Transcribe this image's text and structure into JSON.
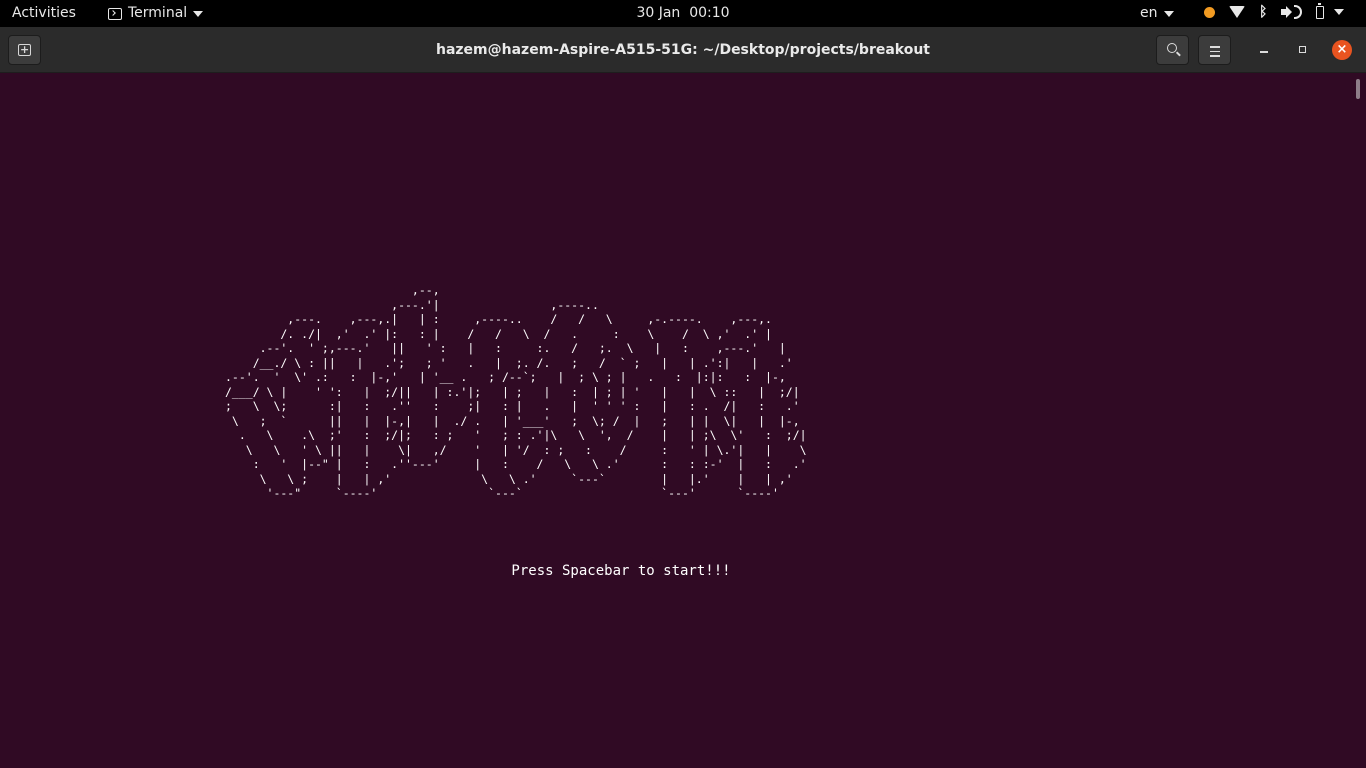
{
  "topbar": {
    "activities": "Activities",
    "app_name": "Terminal",
    "clock_date": "30 Jan",
    "clock_time": "00:10",
    "language": "en",
    "icons": [
      "notification-dot",
      "wifi-icon",
      "bluetooth-icon",
      "volume-icon",
      "battery-icon",
      "system-menu-caret"
    ]
  },
  "window": {
    "title": "hazem@hazem-Aspire-A515-51G: ~/Desktop/projects/breakout",
    "close_glyph": "×"
  },
  "terminal": {
    "ascii_art": "                           ,--,                                            \n                        ,---.'|                ,----..                     \n         ,---.    ,---,.|   | :     ,----..    /   /   \\     ,-.----.    ,---,.\n        /. ./|  ,'  .' |:   : |    /   /   \\  /   .     :    \\    /  \\ ,'  .' |\n     .--'.  ' ;,---.'   ||   ' :   |   :     :.   /   ;.  \\   |   :    ,---.'   |\n    /__./ \\ : ||   |   .';   ; '   .   |  ;. /.   ;   /  ` ;   |   | .':|   |   .'\n.--'.  '  \\' .:   :  |-,'   | '__ .   ; /--`;   |  ; \\ ; |   .   :  |:|:   :  |-,\n/___/ \\ |    ' ':   |  ;/||   | :.'|;   | ;   |   :  | ; | '   |   |  \\ ::   |  ;/|\n;   \\  \\;      :|   :   .''   :    ;|   : |   .   |  ' ' ' :   |   : .  /|   :   .'\n \\   ;  `      ||   |  |-,|   |  ./ .   | '___'   ;  \\; /  |   ;   | |  \\|   |  |-,\n  .   \\    .\\  ;'   :  ;/|;   : ;   '   ; : .'|\\   \\  ',  /    |   | ;\\  \\'   :  ;/|\n   \\   \\   ' \\ ||   |    \\|   ,/    '   | '/  : ;   :    /     :   ' | \\.'|   |    \\\n    :   '  |--\" |   :   .''---'     |   :    /   \\   \\ .'      :   : :-'  |   :   .'\n     \\   \\ ;    |   | ,'             \\   \\ .'     `---`        |   |.'    |   | ,'\n      '---\"     `----'                `---`                    `---'      `----'",
    "prompt": "Press Spacebar to start!!!"
  }
}
